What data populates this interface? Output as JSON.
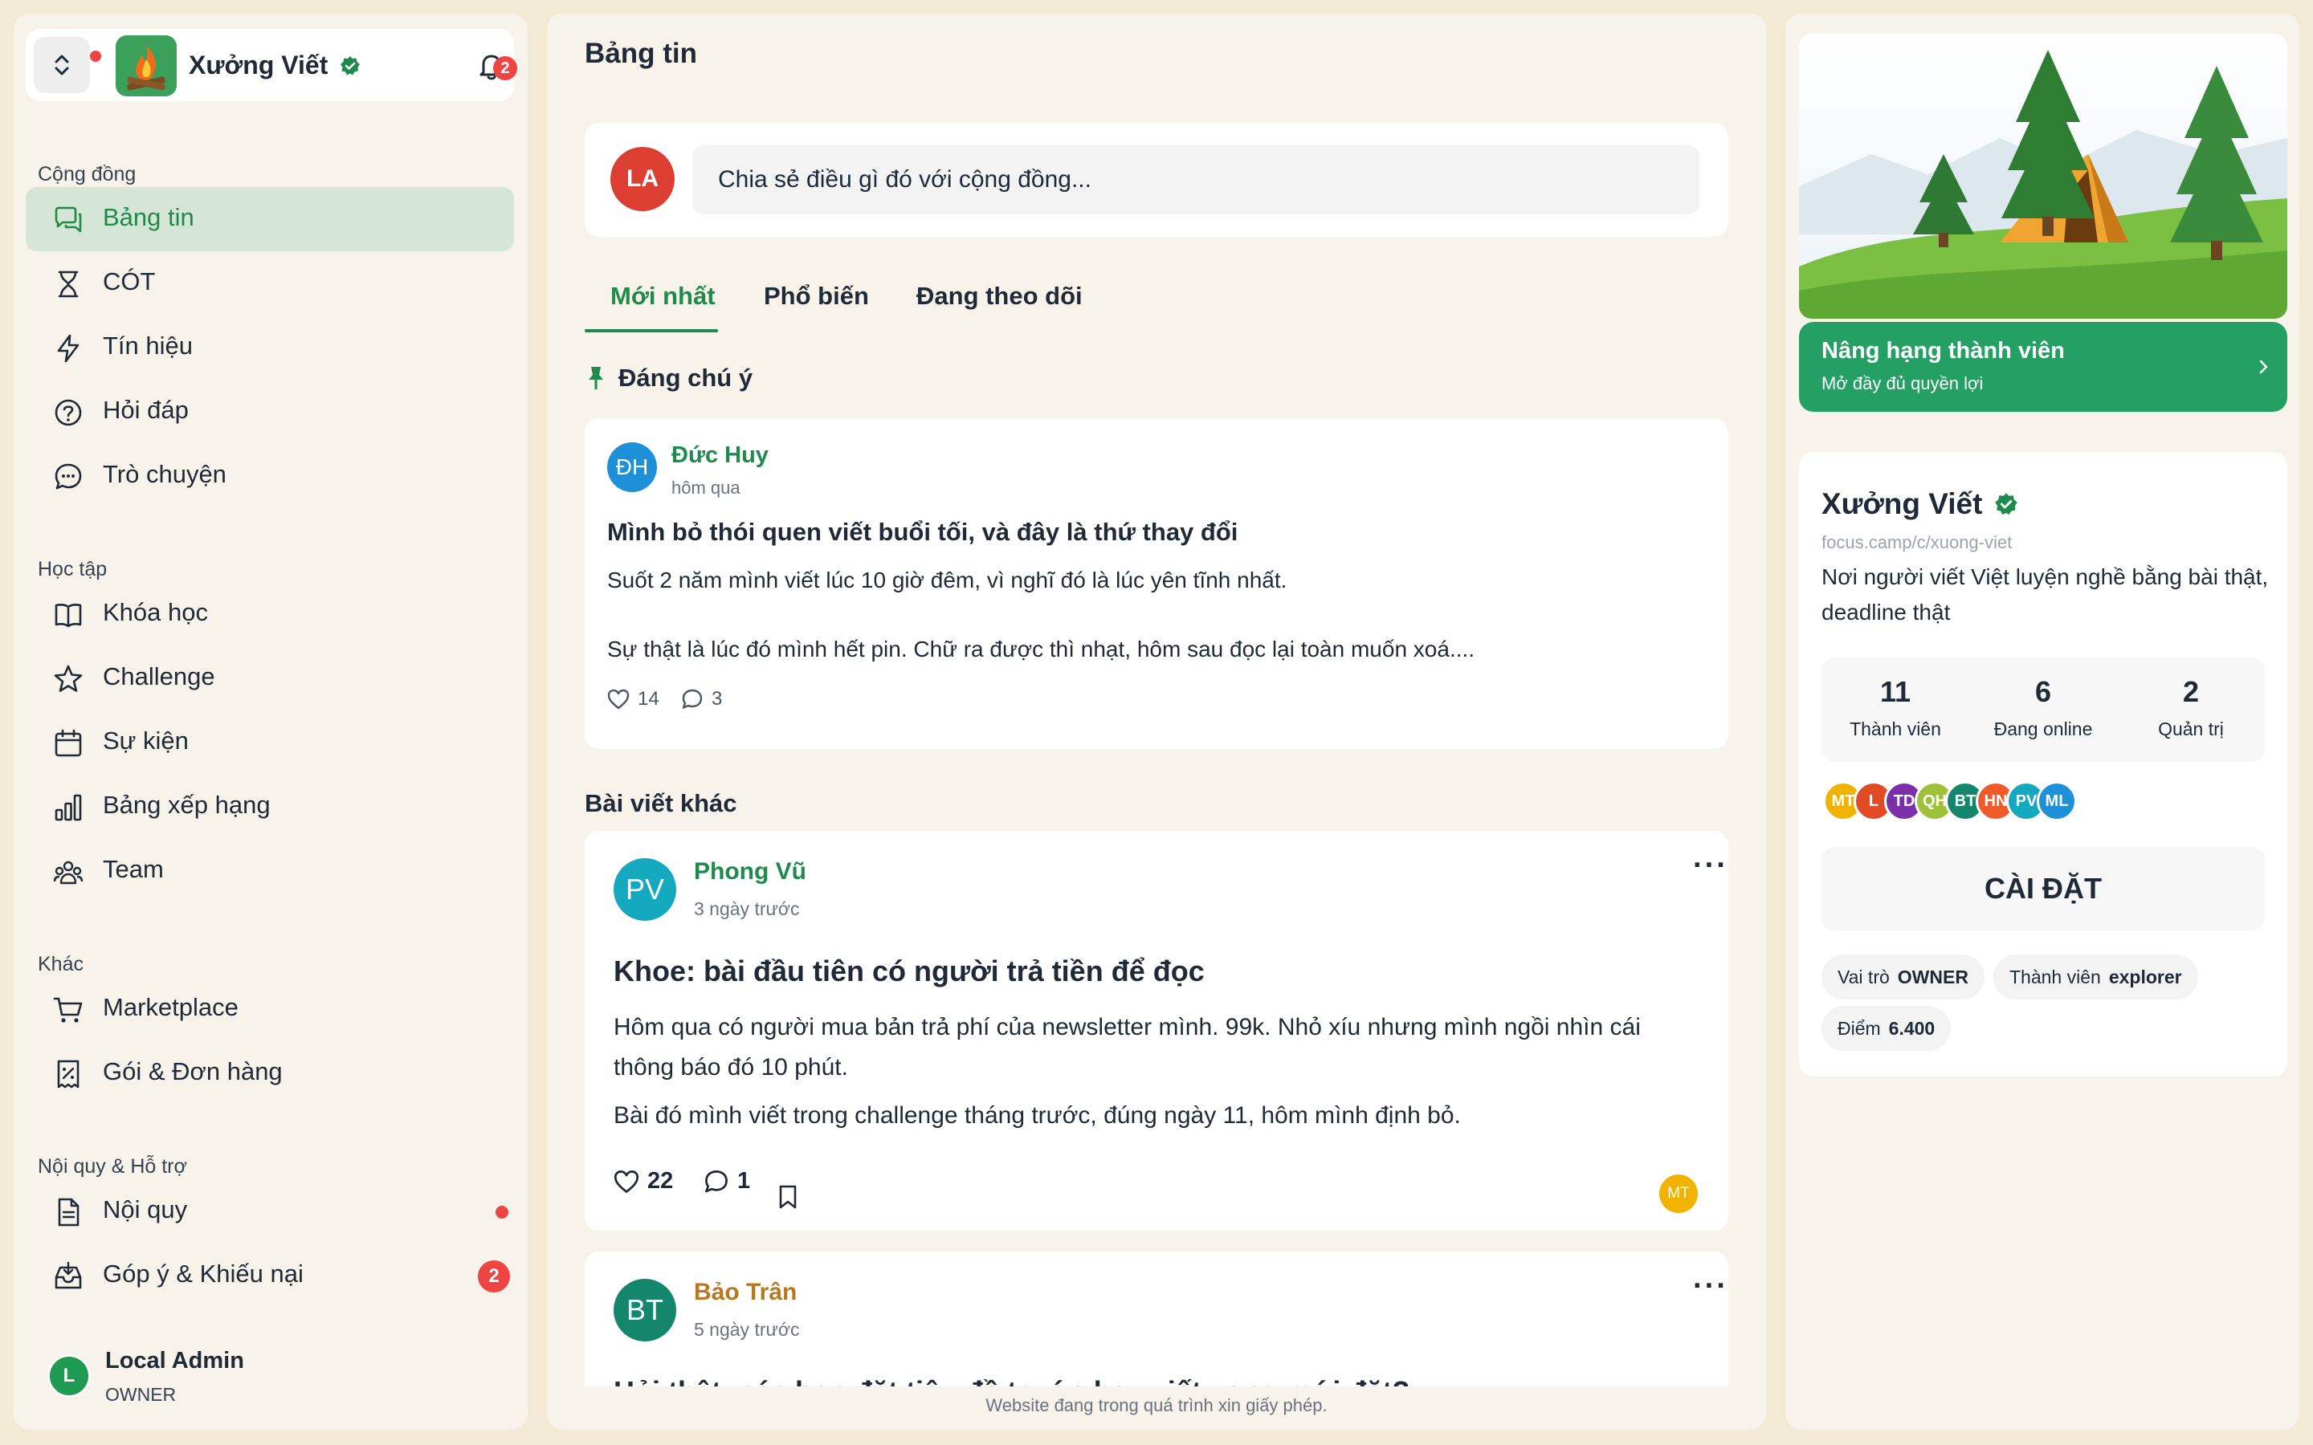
{
  "workspace": {
    "name": "Xưởng Viết",
    "notifications": "2"
  },
  "sidebar": {
    "sections": [
      {
        "title": "Cộng đồng"
      },
      {
        "title": "Học tập"
      },
      {
        "title": "Khác"
      },
      {
        "title": "Nội quy & Hỗ trợ"
      }
    ],
    "items": [
      {
        "label": "Bảng tin",
        "icon": "chat-bubbles-icon",
        "active": true
      },
      {
        "label": "CÓT",
        "icon": "hourglass-icon"
      },
      {
        "label": "Tín hiệu",
        "icon": "lightning-icon"
      },
      {
        "label": "Hỏi đáp",
        "icon": "question-icon"
      },
      {
        "label": "Trò chuyện",
        "icon": "chat-icon"
      },
      {
        "label": "Khóa học",
        "icon": "book-icon"
      },
      {
        "label": "Challenge",
        "icon": "star-icon"
      },
      {
        "label": "Sự kiện",
        "icon": "calendar-icon"
      },
      {
        "label": "Bảng xếp hạng",
        "icon": "bar-chart-icon"
      },
      {
        "label": "Team",
        "icon": "team-icon"
      },
      {
        "label": "Marketplace",
        "icon": "cart-icon"
      },
      {
        "label": "Gói & Đơn hàng",
        "icon": "receipt-icon"
      },
      {
        "label": "Nội quy",
        "icon": "document-icon"
      },
      {
        "label": "Góp ý & Khiếu nại",
        "icon": "inbox-icon",
        "badge": "2"
      }
    ],
    "user": {
      "initial": "L",
      "name": "Local Admin",
      "role": "OWNER"
    }
  },
  "main": {
    "title": "Bảng tin",
    "composer": {
      "initials": "LA",
      "placeholder": "Chia sẻ điều gì đó với cộng đồng..."
    },
    "tabs": [
      {
        "label": "Mới nhất",
        "active": true
      },
      {
        "label": "Phổ biến"
      },
      {
        "label": "Đang theo dõi"
      }
    ],
    "pinned_label": "Đáng chú ý",
    "pinned_post": {
      "initials": "ĐH",
      "author": "Đức Huy",
      "time": "hôm qua",
      "title": "Mình bỏ thói quen viết buổi tối, và đây là thứ thay đổi",
      "line1": "Suốt 2 năm mình viết lúc 10 giờ đêm, vì nghĩ đó là lúc yên tĩnh nhất.",
      "line2": "Sự thật là lúc đó mình hết pin. Chữ ra được thì nhạt, hôm sau đọc lại toàn muốn xoá....",
      "likes": "14",
      "comments": "3"
    },
    "other_label": "Bài viết khác",
    "posts": [
      {
        "initials": "PV",
        "author": "Phong Vũ",
        "time": "3 ngày trước",
        "title": "Khoe: bài đầu tiên có người trả tiền để đọc",
        "para1": "Hôm qua có người mua bản trả phí của newsletter mình. 99k. Nhỏ xíu nhưng mình ngồi nhìn cái thông báo đó 10 phút.",
        "para2": "Bài đó mình viết trong challenge tháng trước, đúng ngày 11, hôm mình định bỏ.",
        "likes": "22",
        "comments": "1",
        "reactor": "MT"
      },
      {
        "initials": "BT",
        "author": "Bảo Trân",
        "time": "5 ngày trước",
        "title": "Hỏi thật: các bạn đặt tiêu đề trước hay viết xong mới đặt?"
      }
    ],
    "footer": "Website đang trong quá trình xin giấy phép."
  },
  "right": {
    "upgrade": {
      "title": "Nâng hạng thành viên",
      "subtitle": "Mở đầy đủ quyền lợi"
    },
    "community": {
      "name": "Xưởng Viết",
      "url": "focus.camp/c/xuong-viet",
      "description": "Nơi người viết Việt luyện nghề bằng bài thật, deadline thật",
      "stats": [
        {
          "value": "11",
          "label": "Thành viên"
        },
        {
          "value": "6",
          "label": "Đang online"
        },
        {
          "value": "2",
          "label": "Quản trị"
        }
      ],
      "member_avatars": [
        "MT",
        "L",
        "TD",
        "QH",
        "BT",
        "HN",
        "PV",
        "ML"
      ],
      "settings_label": "CÀI ĐẶT",
      "chips": [
        {
          "label": "Vai trò",
          "value": "OWNER"
        },
        {
          "label": "Thành viên",
          "value": "explorer"
        },
        {
          "label": "Điểm",
          "value": "6.400"
        }
      ]
    }
  },
  "colors": {
    "accent": "#1f8a4c",
    "upgrade": "#25a064",
    "badge": "#ef4444",
    "avatar_LA": "#dc3f32",
    "avatar_DH": "#1e90d8",
    "avatar_PV": "#14a9bf",
    "avatar_BT": "#14866c",
    "avatar_MT": "#f0b400"
  }
}
